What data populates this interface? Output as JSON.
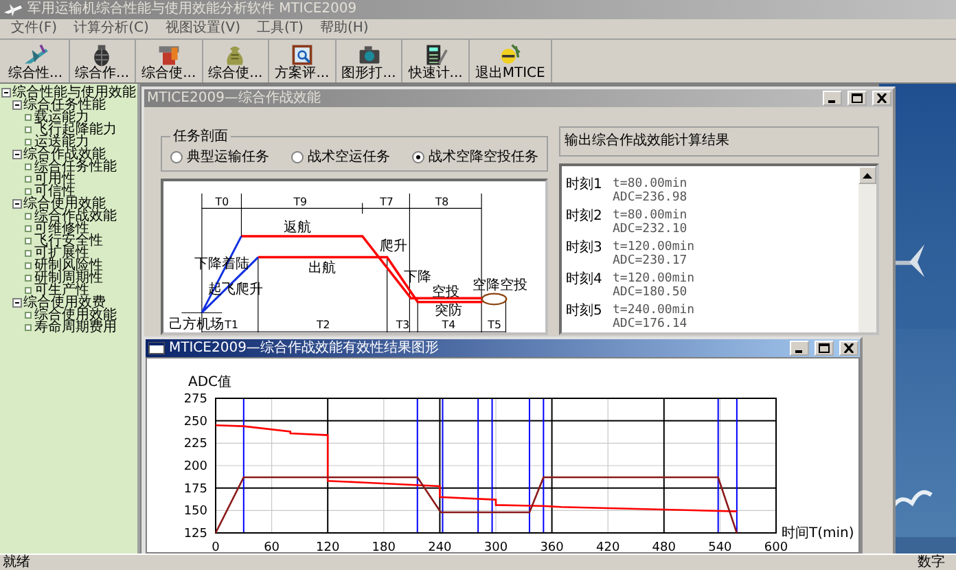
{
  "app": {
    "title": "军用运输机综合性能与使用效能分析软件 MTICE2009"
  },
  "menu": [
    "文件(F)",
    "计算分析(C)",
    "视图设置(V)",
    "工具(T)",
    "帮助(H)"
  ],
  "toolbar": [
    {
      "label": "综合性..."
    },
    {
      "label": "综合作..."
    },
    {
      "label": "综合使..."
    },
    {
      "label": "综合使..."
    },
    {
      "label": "方案评..."
    },
    {
      "label": "图形打..."
    },
    {
      "label": "快速计..."
    },
    {
      "label": "退出MTICE"
    }
  ],
  "tree": [
    {
      "label": "综合性能与使用效能",
      "expanded": true,
      "children": [
        {
          "label": "综合任务性能",
          "expanded": true,
          "children": [
            {
              "label": "载运能力"
            },
            {
              "label": "飞行起降能力"
            },
            {
              "label": "运送能力"
            }
          ]
        },
        {
          "label": "综合作战效能",
          "expanded": true,
          "children": [
            {
              "label": "综合任务性能"
            },
            {
              "label": "可用性"
            },
            {
              "label": "可信性"
            }
          ]
        },
        {
          "label": "综合使用效能",
          "expanded": true,
          "children": [
            {
              "label": "综合作战效能"
            },
            {
              "label": "可维修性"
            },
            {
              "label": "飞行安全性"
            },
            {
              "label": "可扩展性"
            },
            {
              "label": "研制风险性"
            },
            {
              "label": "研制周期性"
            },
            {
              "label": "可生产性"
            }
          ]
        },
        {
          "label": "综合使用效费",
          "expanded": true,
          "children": [
            {
              "label": "综合使用效能"
            },
            {
              "label": "寿命周期费用"
            }
          ]
        }
      ]
    }
  ],
  "effect_window": {
    "title": "MTICE2009—综合作战效能",
    "active": false,
    "mission_group": {
      "title": "任务剖面",
      "options": [
        {
          "label": "典型运输任务",
          "selected": false
        },
        {
          "label": "战术空运任务",
          "selected": false
        },
        {
          "label": "战术空降空投任务",
          "selected": true
        }
      ]
    },
    "profile_diagram": {
      "labels": [
        "T0",
        "T9",
        "T7",
        "T8",
        "返航",
        "出航",
        "爬升",
        "下降着陆",
        "起飞爬升",
        "下降",
        "空投",
        "突防",
        "空降空投",
        "己方机场",
        "T1",
        "T2",
        "T3",
        "T4",
        "T5"
      ]
    },
    "results": {
      "title": "输出综合作战效能计算结果",
      "entries": [
        {
          "label": "时刻1",
          "time": "t=80.00min",
          "adc": "ADC=236.98"
        },
        {
          "label": "时刻2",
          "time": "t=80.00min",
          "adc": "ADC=232.10"
        },
        {
          "label": "时刻3",
          "time": "t=120.00min",
          "adc": "ADC=230.17"
        },
        {
          "label": "时刻4",
          "time": "t=120.00min",
          "adc": "ADC=180.50"
        },
        {
          "label": "时刻5",
          "time": "t=240.00min",
          "adc": "ADC=176.14"
        }
      ]
    }
  },
  "chart_window": {
    "title": "MTICE2009—综合作战效能有效性结果图形",
    "active": true,
    "chart_data": {
      "type": "line",
      "xlabel": "时间T(min)",
      "ylabel": "ADC值",
      "xlim": [
        0,
        600
      ],
      "ylim": [
        125,
        275
      ],
      "xticks": [
        0,
        60,
        120,
        180,
        240,
        300,
        360,
        420,
        480,
        540,
        600
      ],
      "yticks": [
        125,
        150,
        175,
        200,
        225,
        250,
        275
      ],
      "grid": true,
      "series": [
        {
          "color": "#ff0000",
          "x": [
            0,
            30,
            80,
            80,
            120,
            120,
            160,
            240,
            240,
            300,
            300,
            350,
            370,
            480,
            558
          ],
          "values": [
            245,
            244,
            238,
            236,
            234,
            183,
            181,
            177,
            165,
            162,
            156,
            155,
            154,
            151,
            149
          ]
        },
        {
          "color": "#8b1a1a",
          "x": [
            0,
            30,
            216,
            241,
            336,
            351,
            538,
            558
          ],
          "values": [
            125,
            187,
            187,
            148,
            148,
            187,
            187,
            125
          ]
        }
      ],
      "ref_lines": [
        {
          "axis": "x",
          "value": 120,
          "color": "#000000"
        },
        {
          "axis": "x",
          "value": 240,
          "color": "#000000"
        },
        {
          "axis": "x",
          "value": 360,
          "color": "#000000"
        },
        {
          "axis": "x",
          "value": 480,
          "color": "#000000"
        },
        {
          "axis": "y",
          "value": 250,
          "color": "#000000"
        },
        {
          "axis": "y",
          "value": 175,
          "color": "#000000"
        },
        {
          "axis": "x",
          "value": 30,
          "color": "#0000ff"
        },
        {
          "axis": "x",
          "value": 216,
          "color": "#0000ff"
        },
        {
          "axis": "x",
          "value": 243,
          "color": "#0000ff"
        },
        {
          "axis": "x",
          "value": 281,
          "color": "#0000ff"
        },
        {
          "axis": "x",
          "value": 296,
          "color": "#0000ff"
        },
        {
          "axis": "x",
          "value": 336,
          "color": "#0000ff"
        },
        {
          "axis": "x",
          "value": 351,
          "color": "#0000ff"
        },
        {
          "axis": "x",
          "value": 538,
          "color": "#0000ff"
        },
        {
          "axis": "x",
          "value": 558,
          "color": "#0000ff"
        }
      ]
    }
  },
  "status_bar": {
    "left": "就绪",
    "right": "数字"
  }
}
